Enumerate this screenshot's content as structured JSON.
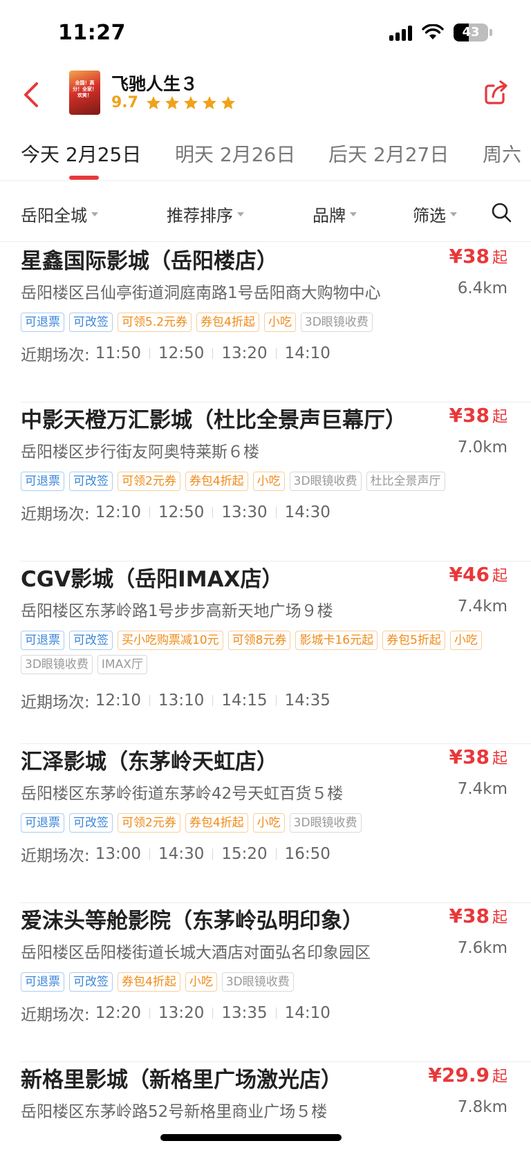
{
  "status": {
    "time": "11:27",
    "battery": "43",
    "battery_level": 0.43
  },
  "header": {
    "movie_title": "飞驰人生３",
    "score": "9.7",
    "stars": 5,
    "poster_text": "全国！高分！全家！欢笑！"
  },
  "date_tabs": [
    {
      "label": "今天 2月25日",
      "active": true
    },
    {
      "label": "明天 2月26日",
      "active": false
    },
    {
      "label": "后天 2月27日",
      "active": false
    },
    {
      "label": "周六",
      "active": false
    }
  ],
  "filters": [
    {
      "label": "岳阳全城"
    },
    {
      "label": "推荐排序"
    },
    {
      "label": "品牌"
    },
    {
      "label": "筛选"
    }
  ],
  "cinemas": [
    {
      "name": "星鑫国际影城（岳阳楼店）",
      "price": "¥38",
      "price_suffix": "起",
      "address": "岳阳楼区吕仙亭街道洞庭南路1号岳阳商大购物中心",
      "distance": "6.4km",
      "tags": [
        {
          "text": "可退票",
          "color": "blue"
        },
        {
          "text": "可改签",
          "color": "blue"
        },
        {
          "text": "可领5.2元券",
          "color": "orange"
        },
        {
          "text": "券包4折起",
          "color": "orange"
        },
        {
          "text": "小吃",
          "color": "orange"
        },
        {
          "text": "3D眼镜收费",
          "color": "gray"
        }
      ],
      "times_label": "近期场次:",
      "times": [
        "11:50",
        "12:50",
        "13:20",
        "14:10"
      ]
    },
    {
      "name": "中影天橙万汇影城（杜比全景声巨幕厅）",
      "price": "¥38",
      "price_suffix": "起",
      "address": "岳阳楼区步行街友阿奥特莱斯６楼",
      "distance": "7.0km",
      "tags": [
        {
          "text": "可退票",
          "color": "blue"
        },
        {
          "text": "可改签",
          "color": "blue"
        },
        {
          "text": "可领2元券",
          "color": "orange"
        },
        {
          "text": "券包4折起",
          "color": "orange"
        },
        {
          "text": "小吃",
          "color": "orange"
        },
        {
          "text": "3D眼镜收费",
          "color": "gray"
        },
        {
          "text": "杜比全景声厅",
          "color": "gray"
        }
      ],
      "times_label": "近期场次:",
      "times": [
        "12:10",
        "12:50",
        "13:30",
        "14:30"
      ]
    },
    {
      "name": "CGV影城（岳阳IMAX店）",
      "price": "¥46",
      "price_suffix": "起",
      "address": "岳阳楼区东茅岭路1号步步高新天地广场９楼",
      "distance": "7.4km",
      "tags": [
        {
          "text": "可退票",
          "color": "blue"
        },
        {
          "text": "可改签",
          "color": "blue"
        },
        {
          "text": "买小吃购票减10元",
          "color": "orange"
        },
        {
          "text": "可领8元券",
          "color": "orange"
        },
        {
          "text": "影城卡16元起",
          "color": "orange"
        },
        {
          "text": "券包5折起",
          "color": "orange"
        },
        {
          "text": "小吃",
          "color": "orange"
        },
        {
          "text": "3D眼镜收费",
          "color": "gray"
        },
        {
          "text": "IMAX厅",
          "color": "gray"
        }
      ],
      "times_label": "近期场次:",
      "times": [
        "12:10",
        "13:10",
        "14:15",
        "14:35"
      ]
    },
    {
      "name": "汇泽影城（东茅岭天虹店）",
      "price": "¥38",
      "price_suffix": "起",
      "address": "岳阳楼区东茅岭街道东茅岭42号天虹百货５楼",
      "distance": "7.4km",
      "tags": [
        {
          "text": "可退票",
          "color": "blue"
        },
        {
          "text": "可改签",
          "color": "blue"
        },
        {
          "text": "可领2元券",
          "color": "orange"
        },
        {
          "text": "券包4折起",
          "color": "orange"
        },
        {
          "text": "小吃",
          "color": "orange"
        },
        {
          "text": "3D眼镜收费",
          "color": "gray"
        }
      ],
      "times_label": "近期场次:",
      "times": [
        "13:00",
        "14:30",
        "15:20",
        "16:50"
      ]
    },
    {
      "name": "爱沫头等舱影院（东茅岭弘明印象）",
      "price": "¥38",
      "price_suffix": "起",
      "address": "岳阳楼区岳阳楼街道长城大酒店对面弘名印象园区",
      "distance": "7.6km",
      "tags": [
        {
          "text": "可退票",
          "color": "blue"
        },
        {
          "text": "可改签",
          "color": "blue"
        },
        {
          "text": "券包4折起",
          "color": "orange"
        },
        {
          "text": "小吃",
          "color": "orange"
        },
        {
          "text": "3D眼镜收费",
          "color": "gray"
        }
      ],
      "times_label": "近期场次:",
      "times": [
        "12:20",
        "13:20",
        "13:35",
        "14:10"
      ]
    },
    {
      "name": "新格里影城（新格里广场激光店）",
      "price": "¥29.9",
      "price_suffix": "起",
      "address": "岳阳楼区东茅岭路52号新格里商业广场５楼",
      "distance": "7.8km",
      "tags": [],
      "times_label": "",
      "times": []
    }
  ],
  "colors": {
    "accent_red": "#e8383b",
    "star": "#f0a21a",
    "tag_blue": "#3a86d8",
    "tag_orange": "#f08a17"
  }
}
